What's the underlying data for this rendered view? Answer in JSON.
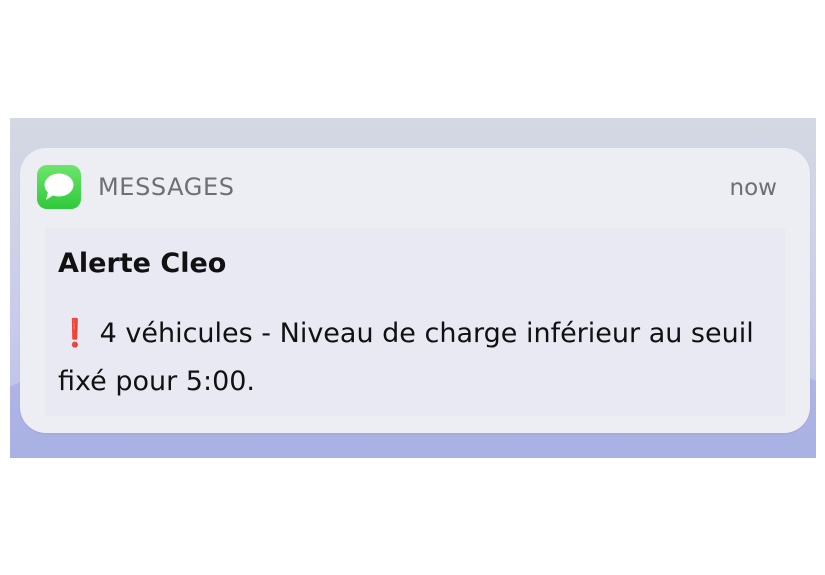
{
  "notification": {
    "app_name": "MESSAGES",
    "timestamp": "now",
    "title": "Alerte Cleo",
    "alert_glyph": "❗",
    "message": "4 véhicules -  Niveau de charge inférieur au seuil fixé pour 5:00."
  },
  "icons": {
    "app_icon": "messages-icon"
  },
  "colors": {
    "app_icon_green": "#34c759",
    "alert_red": "#e0261c",
    "card_background": "#eceef4"
  }
}
